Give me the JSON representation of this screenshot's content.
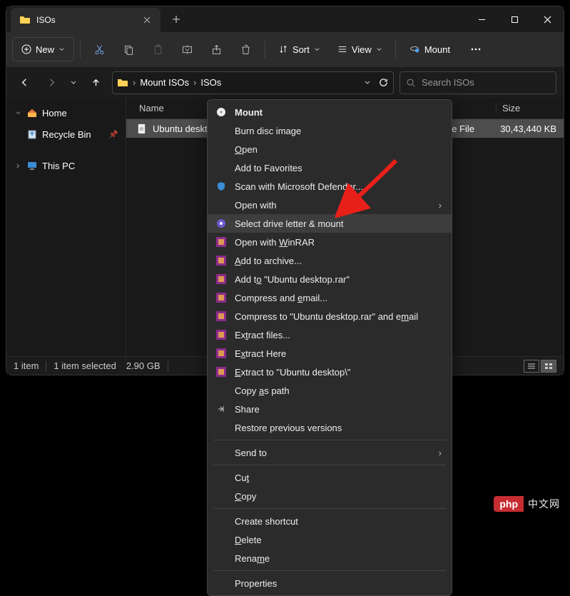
{
  "titlebar": {
    "tab_title": "ISOs"
  },
  "toolbar": {
    "new": "New",
    "sort": "Sort",
    "view": "View",
    "mount": "Mount"
  },
  "nav": {
    "crumb1": "Mount ISOs",
    "crumb2": "ISOs"
  },
  "search": {
    "placeholder": "Search ISOs"
  },
  "sidebar": {
    "home": "Home",
    "recycle": "Recycle Bin",
    "thispc": "This PC"
  },
  "columns": {
    "name": "Name",
    "size": "Size"
  },
  "file": {
    "name": "Ubuntu desktop.",
    "type": "e File",
    "size": "30,43,440 KB"
  },
  "status": {
    "count": "1 item",
    "selected": "1 item selected",
    "size": "2.90 GB"
  },
  "menu": {
    "mount": "Mount",
    "burn": "Burn disc image",
    "open_pre": "",
    "open_u": "O",
    "open_post": "pen",
    "fav": "Add to Favorites",
    "defender": "Scan with Microsoft Defender...",
    "openwith": "Open with",
    "driveletter": "Select drive letter & mount",
    "winrar_pre": "Open with ",
    "winrar_u": "W",
    "winrar_post": "inRAR",
    "archive_pre": "",
    "archive_u": "A",
    "archive_post": "dd to archive...",
    "addto_pre": "Add t",
    "addto_u": "o",
    "addto_post": " \"Ubuntu desktop.rar\"",
    "cemail_pre": "Compress and ",
    "cemail_u": "e",
    "cemail_post": "mail...",
    "cemailto_pre": "Compress to \"Ubuntu desktop.rar\" and e",
    "cemailto_u": "m",
    "cemailto_post": "ail",
    "extfiles_pre": "Ex",
    "extfiles_u": "t",
    "extfiles_post": "ract files...",
    "exthere_pre": "E",
    "exthere_u": "x",
    "exthere_post": "tract Here",
    "extto_pre": "",
    "extto_u": "E",
    "extto_post": "xtract to \"Ubuntu desktop\\\"",
    "copypath_pre": "Copy ",
    "copypath_u": "a",
    "copypath_post": "s path",
    "share": "Share",
    "restore": "Restore previous versions",
    "sendto": "Send to",
    "cut_pre": "Cu",
    "cut_u": "t",
    "cut_post": "",
    "copy_pre": "",
    "copy_u": "C",
    "copy_post": "opy",
    "shortcut": "Create shortcut",
    "delete_pre": "",
    "delete_u": "D",
    "delete_post": "elete",
    "rename_pre": "Rena",
    "rename_u": "m",
    "rename_post": "e",
    "props": "Properties"
  },
  "watermark": {
    "badge": "php",
    "text": "中文网"
  }
}
